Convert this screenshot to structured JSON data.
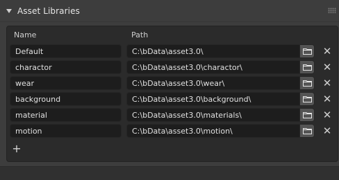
{
  "panel": {
    "title": "Asset Libraries"
  },
  "columns": {
    "name": "Name",
    "path": "Path"
  },
  "libraries": [
    {
      "name": "Default",
      "path": "C:\\bData\\asset3.0\\"
    },
    {
      "name": "charactor",
      "path": "C:\\bData\\asset3.0\\charactor\\"
    },
    {
      "name": "wear",
      "path": "C:\\bData\\asset3.0\\wear\\"
    },
    {
      "name": "background",
      "path": "C:\\bData\\asset3.0\\background\\"
    },
    {
      "name": "material",
      "path": "C:\\bData\\asset3.0\\materials\\"
    },
    {
      "name": "motion",
      "path": "C:\\bData\\asset3.0\\motion\\"
    }
  ],
  "buttons": {
    "remove_glyph": "✕",
    "add_glyph": "+"
  },
  "icons": {
    "collapse": "chevron-down-icon",
    "folder": "folder-icon",
    "remove": "close-icon",
    "add": "plus-icon",
    "drag": "drag-handle-icon"
  }
}
